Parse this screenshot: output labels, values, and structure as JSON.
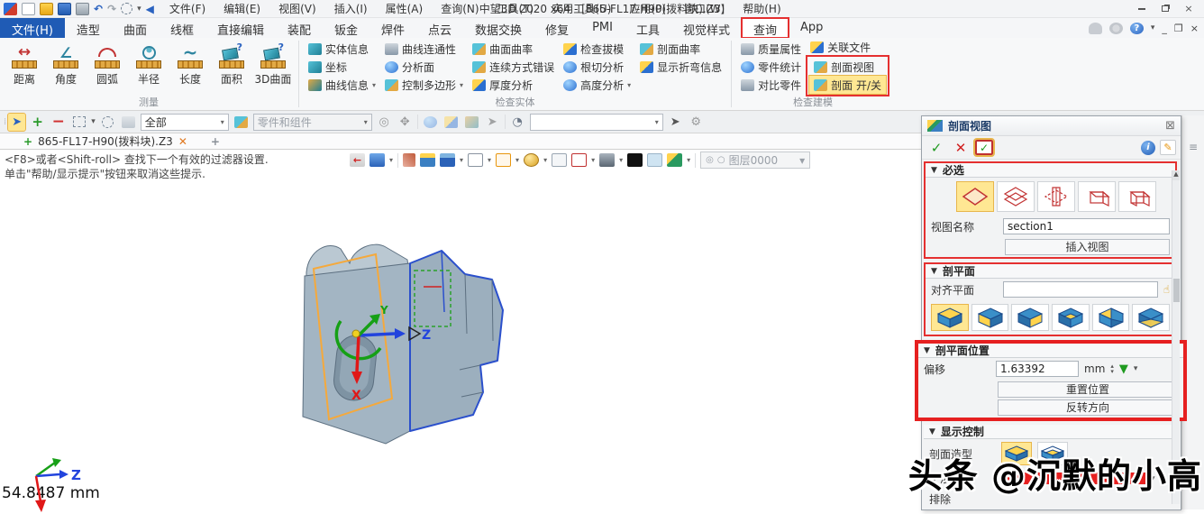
{
  "icons": {
    "dropdown": "▾",
    "check": "✓",
    "cross": "✕",
    "close": "×",
    "plus": "+",
    "minus": "−",
    "menu": "≡",
    "spin_up": "▴",
    "spin_down": "▾",
    "up_arrow": "▲",
    "info": "i",
    "help": "?",
    "undo": "↶",
    "redo": "↷",
    "speaker": "◀",
    "green_down": "▼",
    "pencil": "✎"
  },
  "colors": {
    "accent_blue": "#1f5bb5",
    "annotation_red": "#e53030",
    "highlight_yellow": "#ffe793",
    "model_edge_blue": "#2b50cc",
    "section_plane_orange": "#f5a93c",
    "axis_x": "#e01818",
    "axis_y": "#18a018",
    "axis_z": "#2244dd"
  },
  "titlebar": {
    "title": "中望3D 2020 x64 - [865-FL17-H90(拨料块).Z3]",
    "menus": [
      {
        "label": "文件(F)"
      },
      {
        "label": "编辑(E)"
      },
      {
        "label": "视图(V)"
      },
      {
        "label": "插入(I)"
      },
      {
        "label": "属性(A)"
      },
      {
        "label": "查询(N)"
      },
      {
        "label": "工具(T)"
      },
      {
        "label": "实用工具(U)"
      },
      {
        "label": "应用(P)"
      },
      {
        "label": "窗口(W)"
      },
      {
        "label": "帮助(H)"
      }
    ]
  },
  "ribbon_tabs": {
    "tabs": [
      {
        "label": "文件(H)"
      },
      {
        "label": "造型"
      },
      {
        "label": "曲面"
      },
      {
        "label": "线框"
      },
      {
        "label": "直接编辑"
      },
      {
        "label": "装配"
      },
      {
        "label": "钣金"
      },
      {
        "label": "焊件"
      },
      {
        "label": "点云"
      },
      {
        "label": "数据交换"
      },
      {
        "label": "修复"
      },
      {
        "label": "PMI"
      },
      {
        "label": "工具"
      },
      {
        "label": "视觉样式"
      },
      {
        "label": "查询"
      },
      {
        "label": "App"
      }
    ]
  },
  "ribbon": {
    "measure": {
      "group_label": "测量",
      "buttons": [
        {
          "label": "距离"
        },
        {
          "label": "角度"
        },
        {
          "label": "圆弧"
        },
        {
          "label": "半径"
        },
        {
          "label": "长度"
        },
        {
          "label": "面积"
        },
        {
          "label": "3D曲面"
        }
      ]
    },
    "check_entity": {
      "group_label": "检查实体",
      "col0": [
        {
          "label": "实体信息"
        },
        {
          "label": "坐标"
        },
        {
          "label": "曲线信息"
        }
      ],
      "col1": [
        {
          "label": "曲线连通性"
        },
        {
          "label": "分析面"
        },
        {
          "label": "控制多边形"
        }
      ],
      "col2": [
        {
          "label": "曲面曲率"
        },
        {
          "label": "连续方式错误"
        },
        {
          "label": "厚度分析"
        }
      ],
      "col3": [
        {
          "label": "检查拔模"
        },
        {
          "label": "根切分析"
        },
        {
          "label": "高度分析"
        }
      ],
      "col4": [
        {
          "label": "剖面曲率"
        },
        {
          "label": "显示折弯信息"
        }
      ]
    },
    "check_model": {
      "group_label": "检查建模",
      "col0": [
        {
          "label": "质量属性"
        },
        {
          "label": "零件统计"
        },
        {
          "label": "对比零件"
        }
      ],
      "linked_files": {
        "label": "关联文件"
      },
      "boxed": [
        {
          "label": "剖面视图"
        },
        {
          "label": "剖面 开/关"
        }
      ]
    }
  },
  "selection_toolbar": {
    "scope_value": "全部",
    "entity_filter_value": "零件和组件"
  },
  "document_tabs": {
    "active_tab": "865-FL17-H90(拨料块).Z3"
  },
  "prompt": {
    "line1": "<F8>或者<Shift-roll> 查找下一个有效的过滤器设置.",
    "line2": "单击\"帮助/显示提示\"按钮来取消这些提示."
  },
  "view_toolbar": {
    "layer_value": "图层0000"
  },
  "viewport": {
    "scale_readout": "54.8487 mm",
    "triad": {
      "z": "Z"
    },
    "manipulator": {
      "x": "X",
      "y": "Y",
      "z": "Z"
    }
  },
  "panel": {
    "title": "剖面视图",
    "required": {
      "header": "必选",
      "view_name_label": "视图名称",
      "view_name_value": "section1",
      "insert_view_button": "插入视图"
    },
    "section_plane": {
      "header": "剖平面",
      "align_plane_label": "对齐平面",
      "align_plane_value": ""
    },
    "plane_position": {
      "header": "剖平面位置",
      "offset_label": "偏移",
      "offset_value": "1.63392",
      "offset_unit": "mm",
      "reset_button": "重置位置",
      "reverse_button": "反转方向"
    },
    "display_control": {
      "header": "显示控制",
      "section_shape_label": "剖面造型",
      "interference_label": "干涉",
      "exclude_label": "排除"
    }
  },
  "watermark": {
    "text": "头条 @沉默的小高"
  }
}
